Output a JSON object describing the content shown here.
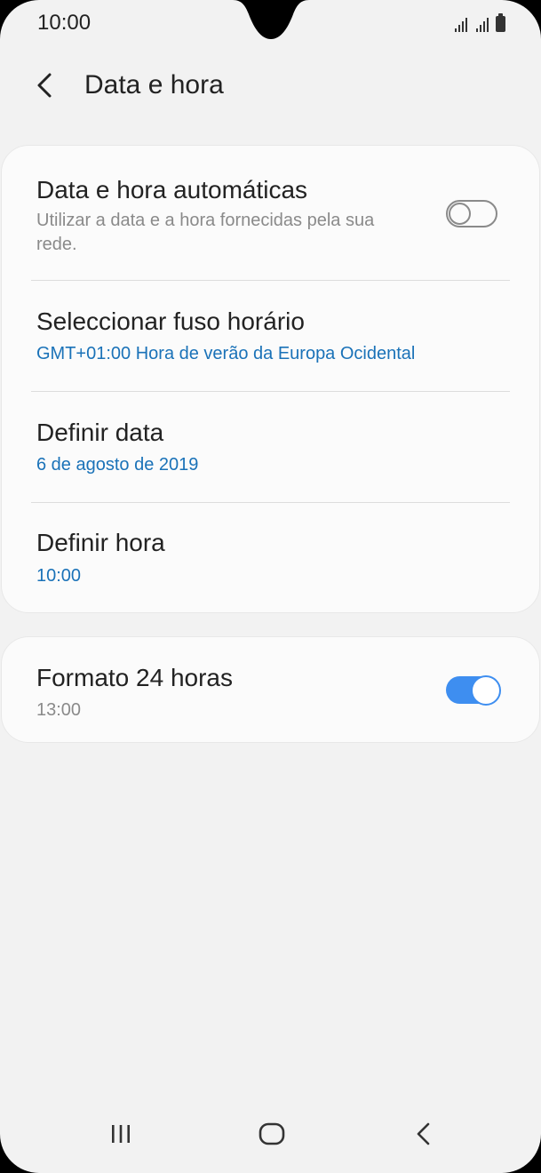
{
  "status_bar": {
    "time": "10:00",
    "icons": [
      "signal-icon",
      "signal-icon",
      "battery-icon"
    ]
  },
  "header": {
    "back_icon": "chevron-left-icon",
    "title": "Data e hora"
  },
  "settings": {
    "auto_datetime": {
      "title": "Data e hora automáticas",
      "subtitle_line1": "Utilizar a data e a hora fornecidas pela sua",
      "subtitle_line2": "rede.",
      "enabled": false
    },
    "timezone": {
      "title": "Seleccionar fuso horário",
      "value": "GMT+01:00 Hora de verão da Europa Ocidental"
    },
    "set_date": {
      "title": "Definir data",
      "value": "6 de agosto de 2019"
    },
    "set_time": {
      "title": "Definir hora",
      "value": "10:00"
    },
    "format_24h": {
      "title": "Formato 24 horas",
      "value": "13:00",
      "enabled": true
    }
  },
  "nav_bar": {
    "icons": [
      "recent-apps-icon",
      "home-icon",
      "back-icon"
    ]
  },
  "colors": {
    "accent": "#3e8ef0",
    "link_blue": "#1a72b8",
    "background": "#f2f2f2"
  }
}
